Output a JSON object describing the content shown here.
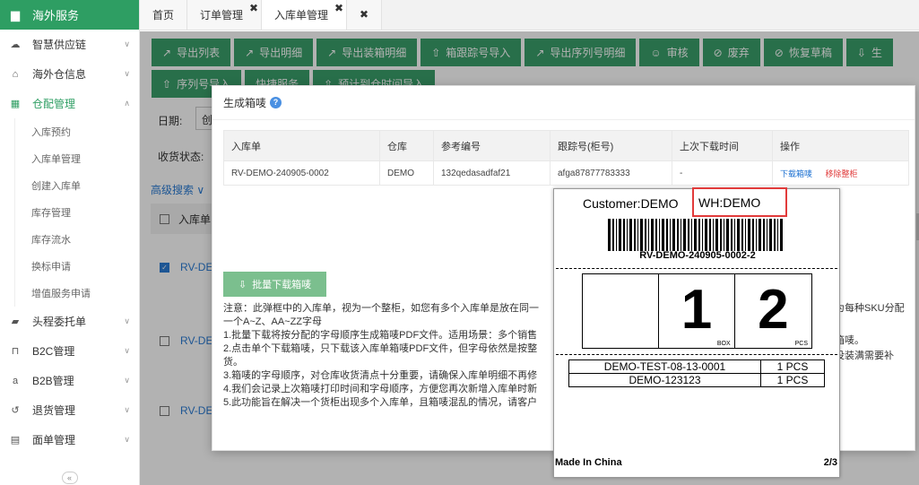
{
  "sidebar": {
    "header": "海外服务",
    "items": [
      {
        "label": "智慧供应链",
        "icon": "cloud-icon"
      },
      {
        "label": "海外仓信息",
        "icon": "home-icon"
      },
      {
        "label": "仓配管理",
        "icon": "grid-icon",
        "active": true
      },
      {
        "label": "头程委托单",
        "icon": "briefcase-icon"
      },
      {
        "label": "B2C管理",
        "icon": "cart-icon"
      },
      {
        "label": "B2B管理",
        "icon": "amazon-icon"
      },
      {
        "label": "退货管理",
        "icon": "return-icon"
      },
      {
        "label": "面单管理",
        "icon": "document-icon"
      }
    ],
    "sub_items": [
      "入库预约",
      "入库单管理",
      "创建入库单",
      "库存管理",
      "库存流水",
      "换标申请",
      "增值服务申请"
    ]
  },
  "tabs": {
    "home": "首页",
    "orders": "订单管理",
    "inbound": "入库单管理",
    "close": "✖"
  },
  "toolbar": [
    {
      "label": "导出列表",
      "icon": "↗"
    },
    {
      "label": "导出明细",
      "icon": "↗"
    },
    {
      "label": "导出装箱明细",
      "icon": "↗"
    },
    {
      "label": "箱跟踪号导入",
      "icon": "⇧"
    },
    {
      "label": "导出序列号明细",
      "icon": "↗"
    },
    {
      "label": "审核",
      "icon": "☺"
    },
    {
      "label": "废弃",
      "icon": "⊘"
    },
    {
      "label": "恢复草稿",
      "icon": "⊘"
    },
    {
      "label": "生",
      "icon": "⇩"
    }
  ],
  "toolbar_row2": [
    {
      "label": "序列号导入",
      "icon": "⇧"
    },
    {
      "label": "快捷服务",
      "icon": ""
    },
    {
      "label": "预计到仓时间导入",
      "icon": "⇧"
    }
  ],
  "filters": {
    "date_label": "日期:",
    "date_value": "创",
    "status_label": "收货状态:",
    "advanced": "高级搜索",
    "col_inbound": "入库单",
    "row_link": "RV-DEM"
  },
  "modal": {
    "title": "生成箱唛",
    "table": {
      "headers": [
        "入库单",
        "仓库",
        "参考编号",
        "跟踪号(柜号)",
        "上次下载时间",
        "操作"
      ],
      "row": {
        "inbound": "RV-DEMO-240905-0002",
        "warehouse": "DEMO",
        "ref": "132qedasadfaf21",
        "tracking": "afga87877783333",
        "last_download": "-",
        "action_download": "下载箱唛",
        "action_remove": "移除整柜"
      }
    },
    "batch_button": "批量下载箱唛",
    "notes": [
      "注意：此弹框中的入库单，视为一个整柜，如您有多个入库单是放在同一",
      "一个A~Z、AA~ZZ字母",
      "1.批量下载将按分配的字母顺序生成箱唛PDF文件。适用场景：多个销售",
      "2.点击单个下载箱唛，只下载该入库单箱唛PDF文件，但字母依然是按整",
      "货。",
      "3.箱唛的字母顺序，对仓库收货清点十分重要，请确保入库单明细不再修",
      "4.我们会记录上次箱唛打印时间和字母顺序，方便您再次新增入库单时新",
      "5.此功能旨在解决一个货柜出现多个入库单，且箱唛混乱的情况，请客户"
    ],
    "notes_right": [
      "为每种SKU分配",
      "箱唛。",
      "没装满需要补"
    ]
  },
  "label_preview": {
    "customer": "Customer:DEMO",
    "warehouse": "WH:DEMO",
    "code": "RV-DEMO-240905-0002-2",
    "box_num": "1",
    "box_unit": "BOX",
    "pcs_num": "2",
    "pcs_unit": "PCS",
    "skus": [
      {
        "sku": "DEMO-TEST-08-13-0001",
        "qty": "1 PCS"
      },
      {
        "sku": "DEMO-123123",
        "qty": "1 PCS"
      }
    ],
    "origin": "Made In China",
    "page": "2/3"
  },
  "colors": {
    "accent": "#2e9e63",
    "button": "#3aa06a",
    "link": "#1a6fd1",
    "danger": "#e03b3b"
  }
}
